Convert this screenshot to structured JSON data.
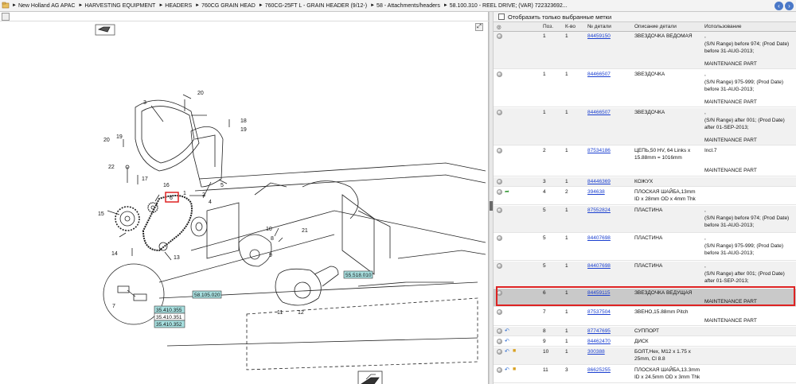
{
  "breadcrumb": {
    "items": [
      "New Holland AG APAC",
      "HARVESTING EQUIPMENT",
      "HEADERS",
      "760CG GRAIN HEAD",
      "760CG-25FT L - GRAIN HEADER (9/12-)",
      "58 - Attachments/headers",
      "58.100.310 - REEL DRIVE; (VAR) 7223236​92..."
    ]
  },
  "filter": {
    "label": "Отобразить только выбранные метки"
  },
  "table": {
    "headers": {
      "pos": "Поз.",
      "qty": "К-во",
      "part_no": "№ детали",
      "description": "Описание детали",
      "usage": "Использование"
    },
    "rows": [
      {
        "pos": "1",
        "qty": "1",
        "part_no": "84459150",
        "description": "ЗВЕЗДОЧКА ВЕДОМАЯ",
        "usage": ",",
        "usage2": "(S/N Range) before 974; (Prod Date) before 31-AUG-2013;",
        "note": "MAINTENANCE PART"
      },
      {
        "pos": "1",
        "qty": "1",
        "part_no": "84466507",
        "description": "ЗВЕЗДОЧКА",
        "usage": ",",
        "usage2": "(S/N Range) 975-999; (Prod Date) before 31-AUG-2013;",
        "note": "MAINTENANCE PART"
      },
      {
        "pos": "1",
        "qty": "1",
        "part_no": "84466507",
        "description": "ЗВЕЗДОЧКА",
        "usage": ",",
        "usage2": "(S/N Range) after 001; (Prod Date) after 01-SEP-2013;",
        "note": "MAINTENANCE PART"
      },
      {
        "pos": "2",
        "qty": "1",
        "part_no": "87534186",
        "description": "ЦЕПЬ,50 HV, 64 Links x 15.88mm = 1016mm",
        "usage": "Incl.7",
        "usage2": "",
        "note": "MAINTENANCE PART"
      },
      {
        "pos": "3",
        "qty": "1",
        "part_no": "84446369",
        "description": "КОЖУХ",
        "usage": "",
        "usage2": "",
        "note": ""
      },
      {
        "pos": "4",
        "qty": "2",
        "part_no": "394638",
        "description": "ПЛОСКАЯ ШАЙБА,13mm ID x 28mm OD x 4mm Thk",
        "usage": "",
        "usage2": "",
        "note": ""
      },
      {
        "pos": "5",
        "qty": "1",
        "part_no": "87552824",
        "description": "ПЛАСТИНА",
        "usage": ",",
        "usage2": "(S/N Range) before 974; (Prod Date) before 31-AUG-2013;",
        "note": ""
      },
      {
        "pos": "5",
        "qty": "1",
        "part_no": "84407698",
        "description": "ПЛАСТИНА",
        "usage": ",",
        "usage2": "(S/N Range) 975-999; (Prod Date) before 31-AUG-2013;",
        "note": ""
      },
      {
        "pos": "5",
        "qty": "1",
        "part_no": "84407698",
        "description": "ПЛАСТИНА",
        "usage": ",",
        "usage2": "(S/N Range) after 001; (Prod Date) after 01-SEP-2013;",
        "note": ""
      },
      {
        "pos": "6",
        "qty": "1",
        "part_no": "84459115",
        "description": "ЗВЕЗДОЧКА ВЕДУЩАЯ",
        "usage": "",
        "usage2": "",
        "note": "MAINTENANCE PART"
      },
      {
        "pos": "7",
        "qty": "1",
        "part_no": "87537504",
        "description": "ЗВЕНО,15.88mm Pitch",
        "usage": "",
        "usage2": "",
        "note": "MAINTENANCE PART"
      },
      {
        "pos": "8",
        "qty": "1",
        "part_no": "87747695",
        "description": "СУППОРТ",
        "usage": "",
        "usage2": "",
        "note": ""
      },
      {
        "pos": "9",
        "qty": "1",
        "part_no": "84462470",
        "description": "ДИСК",
        "usage": "",
        "usage2": "",
        "note": ""
      },
      {
        "pos": "10",
        "qty": "1",
        "part_no": "300388",
        "description": "БОЛТ,Hex, M12 x 1.75 x 25mm, Cl 8.8",
        "usage": "",
        "usage2": "",
        "note": ""
      },
      {
        "pos": "11",
        "qty": "3",
        "part_no": "86625255",
        "description": "ПЛОСКАЯ ШАЙБА,13.3mm ID x 24.5mm OD x 3mm Thk",
        "usage": "",
        "usage2": "",
        "note": ""
      }
    ]
  },
  "diagram": {
    "callouts": [
      "20",
      "3",
      "19",
      "18",
      "20",
      "19",
      "22",
      "17",
      "16",
      "6",
      "2",
      "1",
      "15",
      "14",
      "13",
      "4",
      "5",
      "10",
      "8",
      "21",
      "9",
      "11",
      "12",
      "7"
    ],
    "refs": [
      "55.518.010",
      "58.105.020",
      "35.410.355",
      "35.410.351",
      "35.410.352"
    ]
  },
  "colors": {
    "link": "#1a3fd0",
    "highlight": "#d22222",
    "ref_box": "#a8e0e0"
  }
}
